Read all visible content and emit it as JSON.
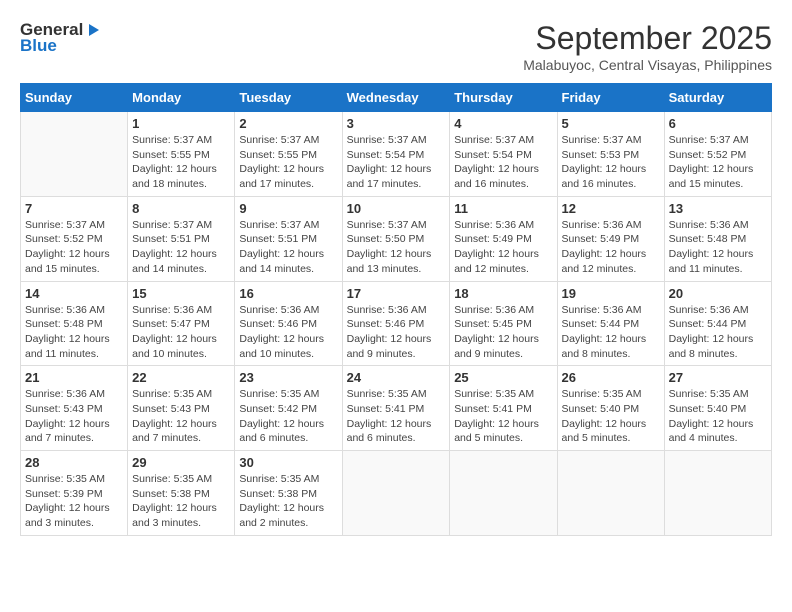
{
  "header": {
    "logo_line1": "General",
    "logo_line2": "Blue",
    "month": "September 2025",
    "location": "Malabuyoc, Central Visayas, Philippines"
  },
  "days_of_week": [
    "Sunday",
    "Monday",
    "Tuesday",
    "Wednesday",
    "Thursday",
    "Friday",
    "Saturday"
  ],
  "weeks": [
    [
      {
        "day": "",
        "info": ""
      },
      {
        "day": "1",
        "info": "Sunrise: 5:37 AM\nSunset: 5:55 PM\nDaylight: 12 hours\nand 18 minutes."
      },
      {
        "day": "2",
        "info": "Sunrise: 5:37 AM\nSunset: 5:55 PM\nDaylight: 12 hours\nand 17 minutes."
      },
      {
        "day": "3",
        "info": "Sunrise: 5:37 AM\nSunset: 5:54 PM\nDaylight: 12 hours\nand 17 minutes."
      },
      {
        "day": "4",
        "info": "Sunrise: 5:37 AM\nSunset: 5:54 PM\nDaylight: 12 hours\nand 16 minutes."
      },
      {
        "day": "5",
        "info": "Sunrise: 5:37 AM\nSunset: 5:53 PM\nDaylight: 12 hours\nand 16 minutes."
      },
      {
        "day": "6",
        "info": "Sunrise: 5:37 AM\nSunset: 5:52 PM\nDaylight: 12 hours\nand 15 minutes."
      }
    ],
    [
      {
        "day": "7",
        "info": "Sunrise: 5:37 AM\nSunset: 5:52 PM\nDaylight: 12 hours\nand 15 minutes."
      },
      {
        "day": "8",
        "info": "Sunrise: 5:37 AM\nSunset: 5:51 PM\nDaylight: 12 hours\nand 14 minutes."
      },
      {
        "day": "9",
        "info": "Sunrise: 5:37 AM\nSunset: 5:51 PM\nDaylight: 12 hours\nand 14 minutes."
      },
      {
        "day": "10",
        "info": "Sunrise: 5:37 AM\nSunset: 5:50 PM\nDaylight: 12 hours\nand 13 minutes."
      },
      {
        "day": "11",
        "info": "Sunrise: 5:36 AM\nSunset: 5:49 PM\nDaylight: 12 hours\nand 12 minutes."
      },
      {
        "day": "12",
        "info": "Sunrise: 5:36 AM\nSunset: 5:49 PM\nDaylight: 12 hours\nand 12 minutes."
      },
      {
        "day": "13",
        "info": "Sunrise: 5:36 AM\nSunset: 5:48 PM\nDaylight: 12 hours\nand 11 minutes."
      }
    ],
    [
      {
        "day": "14",
        "info": "Sunrise: 5:36 AM\nSunset: 5:48 PM\nDaylight: 12 hours\nand 11 minutes."
      },
      {
        "day": "15",
        "info": "Sunrise: 5:36 AM\nSunset: 5:47 PM\nDaylight: 12 hours\nand 10 minutes."
      },
      {
        "day": "16",
        "info": "Sunrise: 5:36 AM\nSunset: 5:46 PM\nDaylight: 12 hours\nand 10 minutes."
      },
      {
        "day": "17",
        "info": "Sunrise: 5:36 AM\nSunset: 5:46 PM\nDaylight: 12 hours\nand 9 minutes."
      },
      {
        "day": "18",
        "info": "Sunrise: 5:36 AM\nSunset: 5:45 PM\nDaylight: 12 hours\nand 9 minutes."
      },
      {
        "day": "19",
        "info": "Sunrise: 5:36 AM\nSunset: 5:44 PM\nDaylight: 12 hours\nand 8 minutes."
      },
      {
        "day": "20",
        "info": "Sunrise: 5:36 AM\nSunset: 5:44 PM\nDaylight: 12 hours\nand 8 minutes."
      }
    ],
    [
      {
        "day": "21",
        "info": "Sunrise: 5:36 AM\nSunset: 5:43 PM\nDaylight: 12 hours\nand 7 minutes."
      },
      {
        "day": "22",
        "info": "Sunrise: 5:35 AM\nSunset: 5:43 PM\nDaylight: 12 hours\nand 7 minutes."
      },
      {
        "day": "23",
        "info": "Sunrise: 5:35 AM\nSunset: 5:42 PM\nDaylight: 12 hours\nand 6 minutes."
      },
      {
        "day": "24",
        "info": "Sunrise: 5:35 AM\nSunset: 5:41 PM\nDaylight: 12 hours\nand 6 minutes."
      },
      {
        "day": "25",
        "info": "Sunrise: 5:35 AM\nSunset: 5:41 PM\nDaylight: 12 hours\nand 5 minutes."
      },
      {
        "day": "26",
        "info": "Sunrise: 5:35 AM\nSunset: 5:40 PM\nDaylight: 12 hours\nand 5 minutes."
      },
      {
        "day": "27",
        "info": "Sunrise: 5:35 AM\nSunset: 5:40 PM\nDaylight: 12 hours\nand 4 minutes."
      }
    ],
    [
      {
        "day": "28",
        "info": "Sunrise: 5:35 AM\nSunset: 5:39 PM\nDaylight: 12 hours\nand 3 minutes."
      },
      {
        "day": "29",
        "info": "Sunrise: 5:35 AM\nSunset: 5:38 PM\nDaylight: 12 hours\nand 3 minutes."
      },
      {
        "day": "30",
        "info": "Sunrise: 5:35 AM\nSunset: 5:38 PM\nDaylight: 12 hours\nand 2 minutes."
      },
      {
        "day": "",
        "info": ""
      },
      {
        "day": "",
        "info": ""
      },
      {
        "day": "",
        "info": ""
      },
      {
        "day": "",
        "info": ""
      }
    ]
  ]
}
